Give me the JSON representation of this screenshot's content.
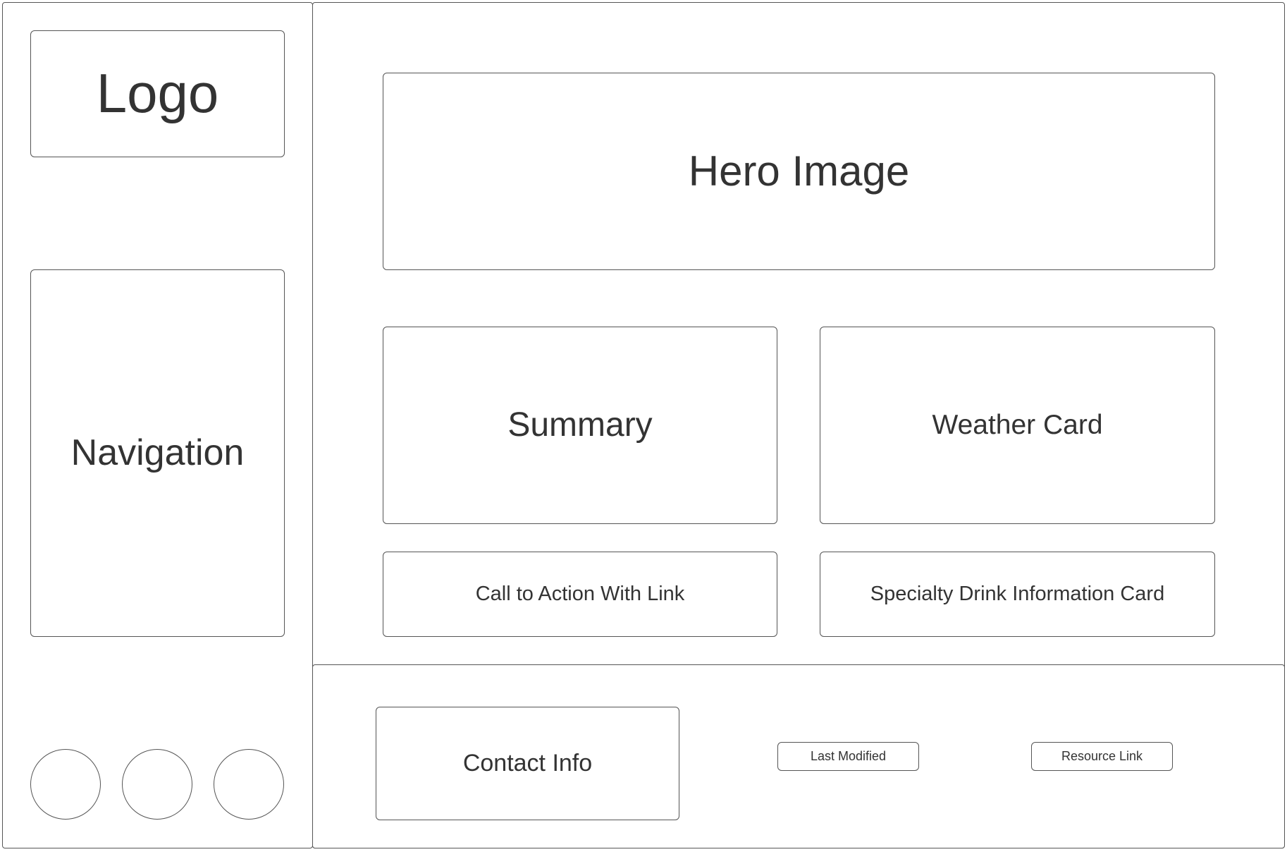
{
  "sidebar": {
    "logo_label": "Logo",
    "navigation_label": "Navigation",
    "social_icons": [
      "circle-placeholder",
      "circle-placeholder",
      "circle-placeholder"
    ]
  },
  "main": {
    "hero_label": "Hero Image",
    "summary_label": "Summary",
    "weather_label": "Weather Card",
    "cta_label": "Call to Action With Link",
    "specialty_label": "Specialty Drink Information Card"
  },
  "footer": {
    "contact_label": "Contact Info",
    "last_modified_label": "Last Modified",
    "resource_link_label": "Resource Link"
  },
  "colors": {
    "stroke": "#555555",
    "text": "#333333",
    "background": "#ffffff"
  }
}
